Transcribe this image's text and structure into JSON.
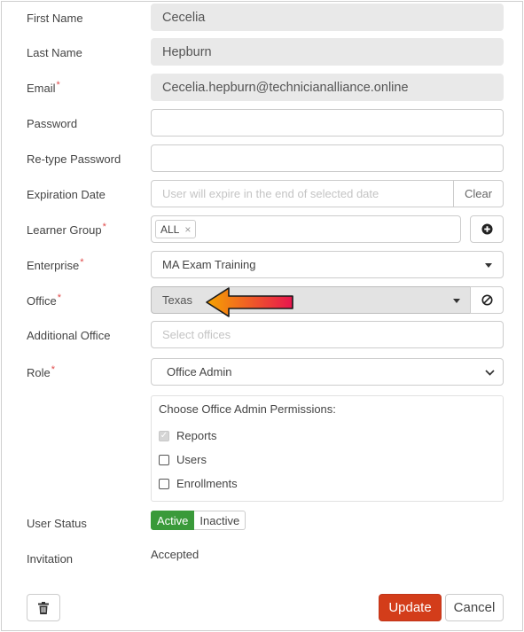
{
  "form": {
    "first_name": {
      "label": "First Name",
      "value": "Cecelia"
    },
    "last_name": {
      "label": "Last Name",
      "value": "Hepburn"
    },
    "email": {
      "label": "Email",
      "required": "*",
      "value": "Cecelia.hepburn@technicianalliance.online"
    },
    "password": {
      "label": "Password",
      "value": ""
    },
    "retype_password": {
      "label": "Re-type Password",
      "value": ""
    },
    "expiration_date": {
      "label": "Expiration Date",
      "placeholder": "User will expire in the end of selected date",
      "clear_label": "Clear"
    },
    "learner_group": {
      "label": "Learner Group",
      "required": "*",
      "tags": [
        "ALL"
      ],
      "remove_glyph": "×"
    },
    "enterprise": {
      "label": "Enterprise",
      "required": "*",
      "value": "MA Exam Training"
    },
    "office": {
      "label": "Office",
      "required": "*",
      "value": "Texas"
    },
    "additional_office": {
      "label": "Additional Office",
      "placeholder": "Select offices"
    },
    "role": {
      "label": "Role",
      "required": "*",
      "value": "Office Admin"
    },
    "permissions": {
      "title": "Choose Office Admin Permissions:",
      "items": [
        {
          "label": "Reports",
          "checked": true,
          "disabled": true
        },
        {
          "label": "Users",
          "checked": false
        },
        {
          "label": "Enrollments",
          "checked": false
        }
      ]
    },
    "user_status": {
      "label": "User Status",
      "active_label": "Active",
      "inactive_label": "Inactive",
      "selected": "Active"
    },
    "invitation": {
      "label": "Invitation",
      "value": "Accepted"
    }
  },
  "footer": {
    "update_label": "Update",
    "cancel_label": "Cancel"
  },
  "annotation": {
    "arrow_gradient": [
      "#f6a400",
      "#e8154e"
    ]
  },
  "colors": {
    "update_button": "#d33d1a",
    "active_status": "#3a9a3a",
    "required_mark": "#e04a4a"
  },
  "icons": {
    "learner_group_add": "plus-circle-icon",
    "office_clear": "ban-icon",
    "delete": "trash-icon",
    "dropdown": "caret-down-icon"
  }
}
